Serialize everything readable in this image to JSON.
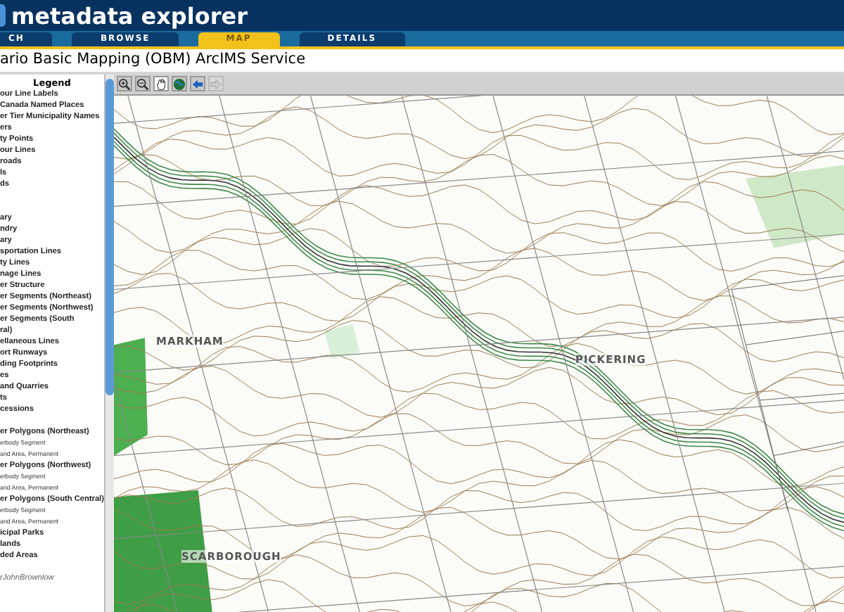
{
  "header": {
    "title": "metadata explorer"
  },
  "tabs": [
    {
      "label": "CH",
      "selected": false
    },
    {
      "label": "BROWSE",
      "selected": false
    },
    {
      "label": "MAP",
      "selected": true
    },
    {
      "label": "DETAILS",
      "selected": false
    }
  ],
  "service_title": "ario Basic Mapping (OBM) ArcIMS Service",
  "legend": {
    "title": "Legend",
    "items": [
      {
        "kind": "item",
        "text": "our Line Labels"
      },
      {
        "kind": "item",
        "text": "Canada Named Places"
      },
      {
        "kind": "item",
        "text": "er Tier Municipality Names"
      },
      {
        "kind": "item",
        "text": "ers"
      },
      {
        "kind": "item",
        "text": "ty Points"
      },
      {
        "kind": "item",
        "text": "our Lines"
      },
      {
        "kind": "item",
        "text": "roads"
      },
      {
        "kind": "item",
        "text": "ls"
      },
      {
        "kind": "item",
        "text": "ds"
      },
      {
        "kind": "spacer"
      },
      {
        "kind": "spacer"
      },
      {
        "kind": "item",
        "text": "ary"
      },
      {
        "kind": "item",
        "text": "ndry"
      },
      {
        "kind": "item",
        "text": "ary"
      },
      {
        "kind": "item",
        "text": "sportation Lines"
      },
      {
        "kind": "item",
        "text": "ty Lines"
      },
      {
        "kind": "item",
        "text": "nage Lines"
      },
      {
        "kind": "item",
        "text": "er Structure"
      },
      {
        "kind": "item",
        "text": "er Segments (Northeast)"
      },
      {
        "kind": "item",
        "text": "er Segments (Northwest)"
      },
      {
        "kind": "item",
        "text": "er Segments (South"
      },
      {
        "kind": "item",
        "text": "ral)"
      },
      {
        "kind": "item",
        "text": "ellaneous Lines"
      },
      {
        "kind": "item",
        "text": "ort Runways"
      },
      {
        "kind": "item",
        "text": "ding Footprints"
      },
      {
        "kind": "item",
        "text": "es"
      },
      {
        "kind": "item",
        "text": "and Quarries"
      },
      {
        "kind": "item",
        "text": "ts"
      },
      {
        "kind": "item",
        "text": "cessions"
      },
      {
        "kind": "spacer"
      },
      {
        "kind": "item",
        "text": "er Polygons (Northeast)"
      },
      {
        "kind": "sub",
        "text": "erbody Segment"
      },
      {
        "kind": "sub",
        "text": "and Area, Permanent"
      },
      {
        "kind": "item",
        "text": "er Polygons (Northwest)"
      },
      {
        "kind": "sub",
        "text": "erbody Segment"
      },
      {
        "kind": "sub",
        "text": "and Area, Permanent"
      },
      {
        "kind": "item",
        "text": "er Polygons (South Central)"
      },
      {
        "kind": "sub",
        "text": "erbody Segment"
      },
      {
        "kind": "sub",
        "text": "and Area, Permanent"
      },
      {
        "kind": "item",
        "text": "icipal Parks"
      },
      {
        "kind": "item",
        "text": "lands"
      },
      {
        "kind": "item",
        "text": "ded Areas"
      },
      {
        "kind": "spacer"
      },
      {
        "kind": "credit",
        "text": "rJohnBrownlow"
      }
    ]
  },
  "tools": [
    {
      "kind": "zoom-in",
      "selected": false,
      "disabled": false
    },
    {
      "kind": "zoom-out",
      "selected": false,
      "disabled": false
    },
    {
      "kind": "pan",
      "selected": true,
      "disabled": false
    },
    {
      "kind": "globe",
      "selected": false,
      "disabled": false
    },
    {
      "kind": "back",
      "selected": false,
      "disabled": false
    },
    {
      "kind": "forward",
      "selected": false,
      "disabled": true
    }
  ],
  "map_labels": [
    {
      "text": "MARKHAM"
    },
    {
      "text": "PICKERING"
    },
    {
      "text": "SCARBOROUGH"
    }
  ]
}
